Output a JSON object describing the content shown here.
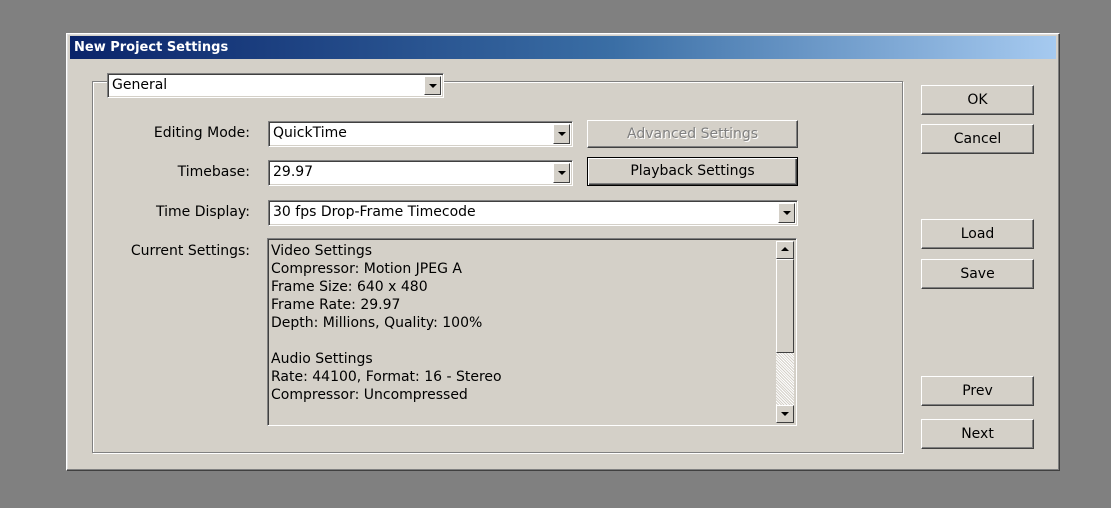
{
  "window": {
    "title": "New Project Settings"
  },
  "category": {
    "selected": "General"
  },
  "fields": {
    "editing_mode": {
      "label": "Editing Mode:",
      "value": "QuickTime"
    },
    "timebase": {
      "label": "Timebase:",
      "value": "29.97"
    },
    "time_display": {
      "label": "Time Display:",
      "value": "30 fps Drop-Frame Timecode"
    },
    "current_settings": {
      "label": "Current Settings:"
    }
  },
  "buttons": {
    "advanced_settings": "Advanced Settings",
    "playback_settings": "Playback Settings",
    "ok": "OK",
    "cancel": "Cancel",
    "load": "Load",
    "save": "Save",
    "prev": "Prev",
    "next": "Next"
  },
  "current_settings_lines": [
    "Video Settings",
    "Compressor: Motion JPEG A",
    "Frame Size: 640 x 480",
    "Frame Rate: 29.97",
    "Depth: Millions, Quality: 100%",
    "",
    "Audio Settings",
    "Rate: 44100, Format: 16 - Stereo",
    "Compressor: Uncompressed"
  ],
  "colors": {
    "dialog_bg": "#d4d0c8",
    "title_gradient_start": "#0a246a",
    "title_gradient_end": "#a6caf0",
    "desktop": "#808080"
  }
}
